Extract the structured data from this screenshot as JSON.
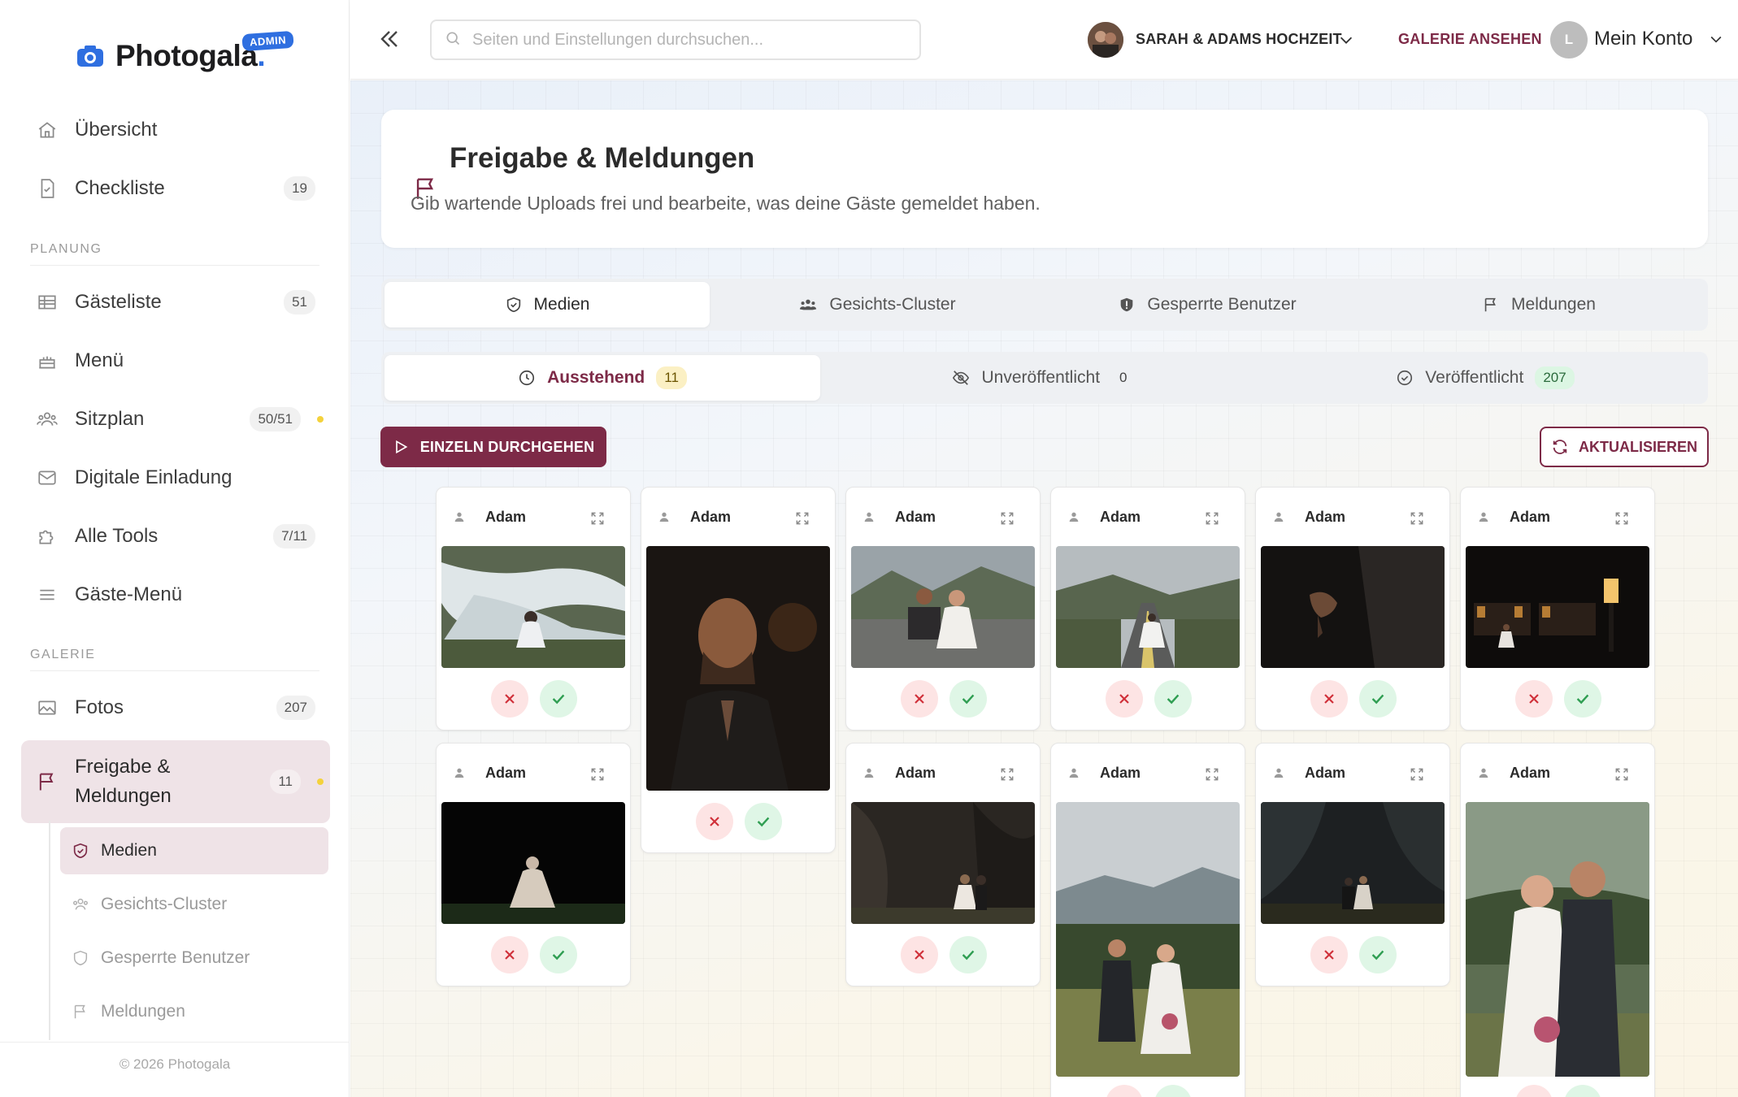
{
  "app": {
    "name": "Photogala",
    "admin_badge": "ADMIN"
  },
  "sidebar": {
    "items": [
      {
        "label": "Übersicht"
      },
      {
        "label": "Checkliste",
        "badge": "19"
      }
    ],
    "section_planung": "PLANUNG",
    "planung_items": [
      {
        "label": "Gästeliste",
        "badge": "51"
      },
      {
        "label": "Menü"
      },
      {
        "label": "Sitzplan",
        "badge": "50/51"
      },
      {
        "label": "Digitale Einladung"
      },
      {
        "label": "Alle Tools",
        "badge": "7/11"
      },
      {
        "label": "Gäste-Menü"
      }
    ],
    "section_galerie": "GALERIE",
    "galerie_items": [
      {
        "label": "Fotos",
        "badge": "207"
      },
      {
        "label": "Freigabe & Meldungen",
        "label_line1": "Freigabe &",
        "label_line2": "Meldungen",
        "badge": "11"
      }
    ],
    "sub_items": [
      {
        "label": "Medien"
      },
      {
        "label": "Gesichts-Cluster"
      },
      {
        "label": "Gesperrte Benutzer"
      },
      {
        "label": "Meldungen"
      }
    ],
    "footer": "© 2026 Photogala"
  },
  "topbar": {
    "search_placeholder": "Seiten und Einstellungen durchsuchen...",
    "event_name": "SARAH & ADAMS HOCHZEIT",
    "view_gallery": "GALERIE ANSEHEN",
    "account_initial": "L",
    "account_label": "Mein Konto"
  },
  "page": {
    "title": "Freigabe & Meldungen",
    "subtitle": "Gib wartende Uploads frei und bearbeite, was deine Gäste gemeldet haben."
  },
  "tabs": [
    {
      "label": "Medien"
    },
    {
      "label": "Gesichts-Cluster"
    },
    {
      "label": "Gesperrte Benutzer"
    },
    {
      "label": "Meldungen"
    }
  ],
  "status_tabs": [
    {
      "label": "Ausstehend",
      "count": "11"
    },
    {
      "label": "Unveröffentlicht",
      "count": "0"
    },
    {
      "label": "Veröffentlicht",
      "count": "207"
    }
  ],
  "actions": {
    "review_single": "EINZELN DURCHGEHEN",
    "refresh": "AKTUALISIEREN"
  },
  "cards": [
    {
      "uploader": "Adam"
    },
    {
      "uploader": "Adam"
    },
    {
      "uploader": "Adam"
    },
    {
      "uploader": "Adam"
    },
    {
      "uploader": "Adam"
    },
    {
      "uploader": "Adam"
    },
    {
      "uploader": "Adam"
    },
    {
      "uploader": "Adam"
    },
    {
      "uploader": "Adam"
    },
    {
      "uploader": "Adam"
    },
    {
      "uploader": "Adam"
    }
  ],
  "colors": {
    "accent": "#7d2a47",
    "brand": "#2f6fe0",
    "reject": "#d0303a",
    "approve": "#2f9e52"
  }
}
